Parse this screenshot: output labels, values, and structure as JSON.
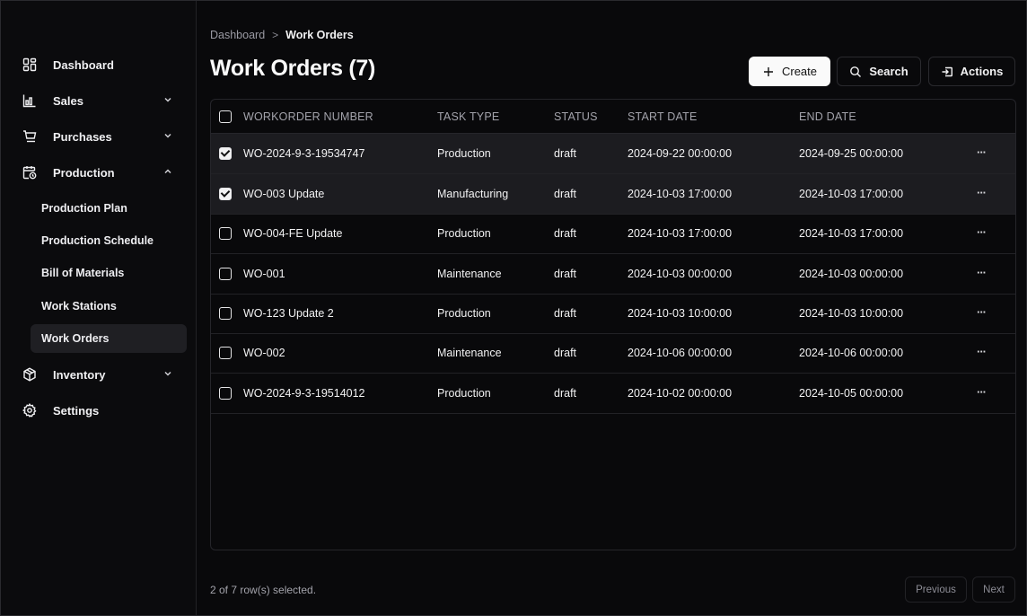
{
  "sidebar": {
    "items": [
      {
        "label": "Dashboard",
        "icon": "dashboard-icon"
      },
      {
        "label": "Sales",
        "icon": "bar-chart-icon",
        "expanded": false
      },
      {
        "label": "Purchases",
        "icon": "cart-icon",
        "expanded": false
      },
      {
        "label": "Production",
        "icon": "calendar-clock-icon",
        "expanded": true
      },
      {
        "label": "Inventory",
        "icon": "box-icon",
        "expanded": false
      },
      {
        "label": "Settings",
        "icon": "gear-icon"
      }
    ],
    "production_sub": [
      {
        "label": "Production Plan"
      },
      {
        "label": "Production Schedule"
      },
      {
        "label": "Bill of Materials"
      },
      {
        "label": "Work Stations"
      },
      {
        "label": "Work Orders",
        "active": true
      }
    ]
  },
  "breadcrumb": {
    "root": "Dashboard",
    "separator": ">",
    "current": "Work Orders"
  },
  "page": {
    "title": "Work Orders (7)"
  },
  "toolbar": {
    "create_label": "Create",
    "search_label": "Search",
    "actions_label": "Actions"
  },
  "table": {
    "columns": [
      "WORKORDER NUMBER",
      "TASK TYPE",
      "STATUS",
      "START DATE",
      "END DATE"
    ],
    "rows": [
      {
        "selected": true,
        "number": "WO-2024-9-3-19534747",
        "task": "Production",
        "status": "draft",
        "start": "2024-09-22 00:00:00",
        "end": "2024-09-25 00:00:00",
        "menu": "···"
      },
      {
        "selected": true,
        "number": "WO-003 Update",
        "task": "Manufacturing",
        "status": "draft",
        "start": "2024-10-03 17:00:00",
        "end": "2024-10-03 17:00:00",
        "menu": "···"
      },
      {
        "selected": false,
        "number": "WO-004-FE Update",
        "task": "Production",
        "status": "draft",
        "start": "2024-10-03 17:00:00",
        "end": "2024-10-03 17:00:00",
        "menu": "···"
      },
      {
        "selected": false,
        "number": "WO-001",
        "task": "Maintenance",
        "status": "draft",
        "start": "2024-10-03 00:00:00",
        "end": "2024-10-03 00:00:00",
        "menu": "···"
      },
      {
        "selected": false,
        "number": "WO-123 Update 2",
        "task": "Production",
        "status": "draft",
        "start": "2024-10-03 10:00:00",
        "end": "2024-10-03 10:00:00",
        "menu": "···"
      },
      {
        "selected": false,
        "number": "WO-002",
        "task": "Maintenance",
        "status": "draft",
        "start": "2024-10-06 00:00:00",
        "end": "2024-10-06 00:00:00",
        "menu": "···"
      },
      {
        "selected": false,
        "number": "WO-2024-9-3-19514012",
        "task": "Production",
        "status": "draft",
        "start": "2024-10-02 00:00:00",
        "end": "2024-10-05 00:00:00",
        "menu": "···"
      }
    ]
  },
  "footer": {
    "selection_text": "2 of 7 row(s) selected.",
    "previous_label": "Previous",
    "next_label": "Next"
  },
  "colors": {
    "background": "#09090b",
    "selected_row": "#1c1c20",
    "primary_button": "#fafafa"
  }
}
